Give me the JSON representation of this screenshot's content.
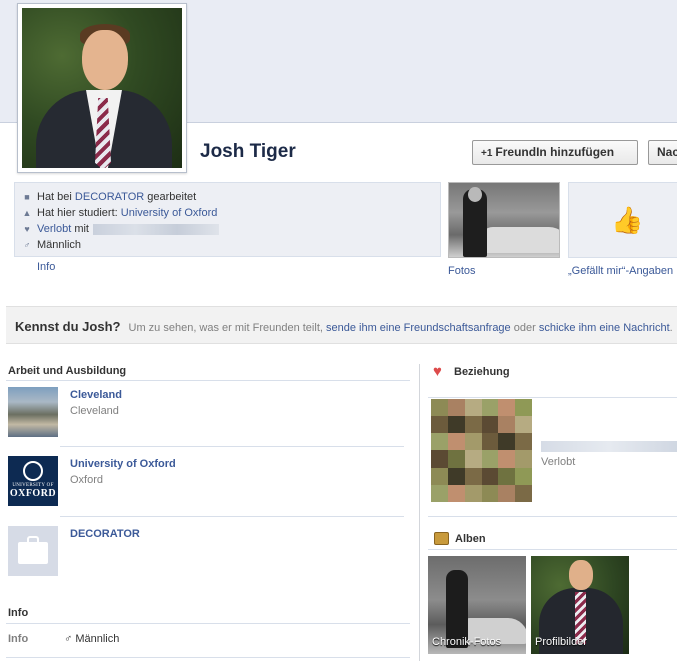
{
  "profile": {
    "name": "Josh Tiger"
  },
  "buttons": {
    "add_friend_prefix": "+1",
    "add_friend": "FreundIn hinzufügen",
    "message": "Nac"
  },
  "intro": {
    "work_prefix": "Hat bei",
    "work_link": "DECORATOR",
    "work_suffix": "gearbeitet",
    "study_prefix": "Hat hier studiert:",
    "study_link": "University of Oxford",
    "relationship_link": "Verlobt",
    "relationship_suffix": "mit",
    "gender": "Männlich",
    "info_link": "Info"
  },
  "thumbnails": {
    "photos_label": "Fotos",
    "likes_label": "„Gefällt mir“-Angaben"
  },
  "know_bar": {
    "heading": "Kennst du Josh?",
    "text_before": "Um zu sehen, was er mit Freunden teilt,",
    "link_request": "sende ihm eine Freundschaftsanfrage",
    "text_or": "oder",
    "link_message": "schicke ihm eine Nachricht",
    "text_end": "."
  },
  "work_education": {
    "title": "Arbeit und Ausbildung",
    "items": [
      {
        "name": "Cleveland",
        "detail": "Cleveland"
      },
      {
        "name": "University of Oxford",
        "detail": "Oxford"
      },
      {
        "name": "DECORATOR",
        "detail": ""
      }
    ],
    "oxford_logo": {
      "line1": "UNIVERSITY OF",
      "line2": "OXFORD"
    }
  },
  "info_section": {
    "title": "Info",
    "rows": [
      {
        "key": "Info",
        "value": "Männlich"
      }
    ]
  },
  "relationship": {
    "title": "Beziehung",
    "status": "Verlobt"
  },
  "albums": {
    "title": "Alben",
    "items": [
      {
        "caption": "Chronik-Fotos"
      },
      {
        "caption": "Profilbilder"
      }
    ]
  },
  "colors": {
    "link": "#3b5998",
    "heart": "#dd4b4b",
    "cover": "#e9ecf4"
  },
  "icons": [
    "briefcase-icon",
    "graduation-cap-icon",
    "heart-icon",
    "male-icon",
    "thumbs-up-icon",
    "album-icon"
  ]
}
